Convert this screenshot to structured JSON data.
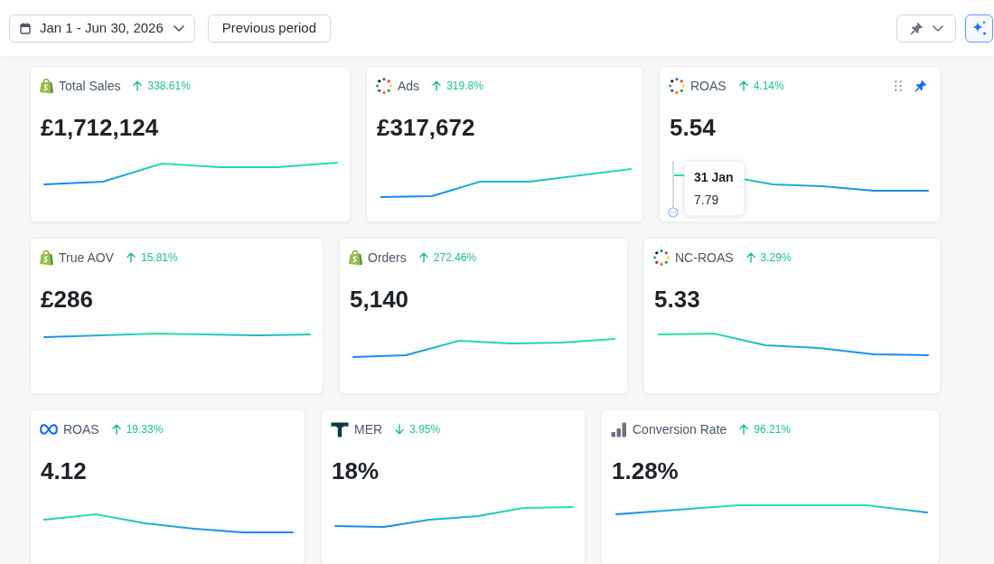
{
  "toolbar": {
    "date_range": "Jan 1 - Jun 30, 2026",
    "compare": "Previous period"
  },
  "rows": [
    {
      "cards": [
        {
          "kind": "bag",
          "title": "Total Sales",
          "rising": true,
          "change": "338.61%",
          "value": "£1,712,124",
          "hovered": false
        },
        {
          "kind": "dots",
          "title": "Ads",
          "rising": true,
          "change": "319.8%",
          "value": "£317,672",
          "hovered": false
        },
        {
          "kind": "dots",
          "title": "ROAS",
          "rising": true,
          "change": "4.14%",
          "value": "5.54",
          "hovered": true,
          "tooltip": {
            "date": "31 Jan",
            "value": "7.79"
          }
        }
      ]
    },
    {
      "cards": [
        {
          "kind": "bag",
          "title": "True AOV",
          "rising": true,
          "change": "15.81%",
          "value": "£286",
          "hovered": false
        },
        {
          "kind": "bag",
          "title": "Orders",
          "rising": true,
          "change": "272.46%",
          "value": "5,140",
          "hovered": false
        },
        {
          "kind": "dots",
          "title": "NC-ROAS",
          "rising": true,
          "change": "3.29%",
          "value": "5.33",
          "hovered": false
        }
      ]
    },
    {
      "cards": [
        {
          "kind": "infinity",
          "title": "ROAS",
          "rising": true,
          "change": "19.33%",
          "value": "4.12",
          "hovered": false
        },
        {
          "kind": "tee",
          "title": "MER",
          "rising": false,
          "change": "3.95%",
          "value": "18%",
          "hovered": false
        },
        {
          "kind": "bars",
          "title": "Conversion Rate",
          "rising": true,
          "change": "96.21%",
          "value": "1.28%",
          "hovered": false
        }
      ]
    }
  ]
}
